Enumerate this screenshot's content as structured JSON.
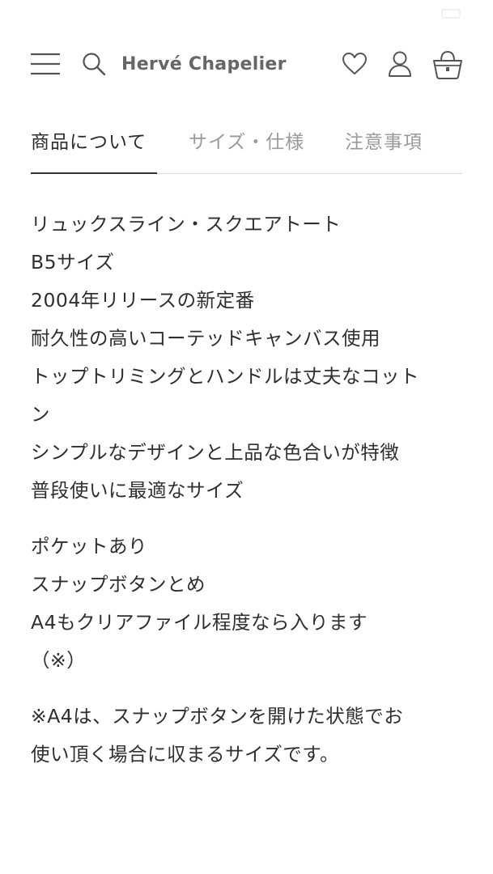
{
  "brand": {
    "logo_text": "Hervé Chapelier"
  },
  "tabs": [
    {
      "label": "商品について",
      "active": true
    },
    {
      "label": "サイズ・仕様",
      "active": false
    },
    {
      "label": "注意事項",
      "active": false
    }
  ],
  "description": {
    "features": [
      "リュックスライン・スクエアトート",
      "B5サイズ",
      "2004年リリースの新定番",
      "耐久性の高いコーテッドキャンバス使用",
      "トップトリミングとハンドルは丈夫なコット",
      "ン",
      "シンプルなデザインと上品な色合いが特徴",
      "普段使いに最適なサイズ"
    ],
    "specs": [
      "ポケットあり",
      "スナップボタンとめ",
      "A4もクリアファイル程度なら入ります",
      "（※）"
    ],
    "note": [
      "※A4は、スナップボタンを開けた状態でお",
      "使い頂く場合に収まるサイズです。"
    ]
  },
  "icons": {
    "menu": "menu-icon",
    "search": "search-icon",
    "favorite": "heart-icon",
    "account": "user-icon",
    "cart": "bag-icon"
  },
  "colors": {
    "text": "#2f2f2f",
    "muted": "#9a9a9a",
    "icon": "#555555",
    "divider": "#d9d9d9"
  }
}
